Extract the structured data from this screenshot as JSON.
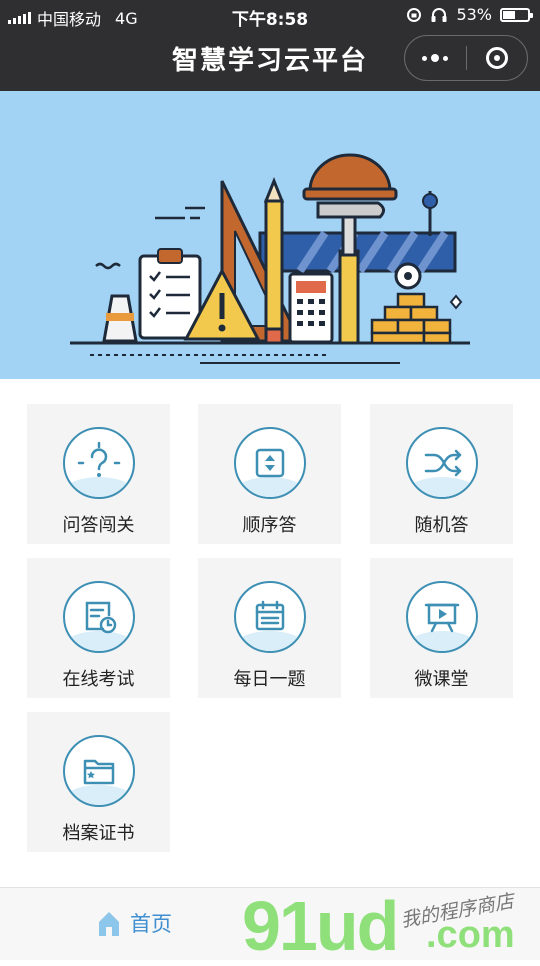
{
  "status_bar": {
    "carrier": "中国移动",
    "network": "4G",
    "time": "下午8:58",
    "battery": "53%",
    "battery_level": 0.53
  },
  "nav": {
    "title": "智慧学习云平台"
  },
  "menu": {
    "items": [
      {
        "label": "问答闯关",
        "icon": "question-icon"
      },
      {
        "label": "顺序答",
        "icon": "sort-icon"
      },
      {
        "label": "随机答",
        "icon": "shuffle-icon"
      },
      {
        "label": "在线考试",
        "icon": "exam-clock-icon"
      },
      {
        "label": "每日一题",
        "icon": "calendar-icon"
      },
      {
        "label": "微课堂",
        "icon": "presentation-icon"
      },
      {
        "label": "档案证书",
        "icon": "folder-icon"
      }
    ]
  },
  "tabbar": {
    "home_label": "首页"
  },
  "watermark": {
    "logo": "91ud",
    "domain": ".com",
    "caption": "我的程序商店"
  },
  "colors": {
    "topbar": "#2f2f31",
    "banner": "#a2d3f5",
    "icon_stroke": "#3d8fb4",
    "tab_active": "#3f8fd0"
  }
}
